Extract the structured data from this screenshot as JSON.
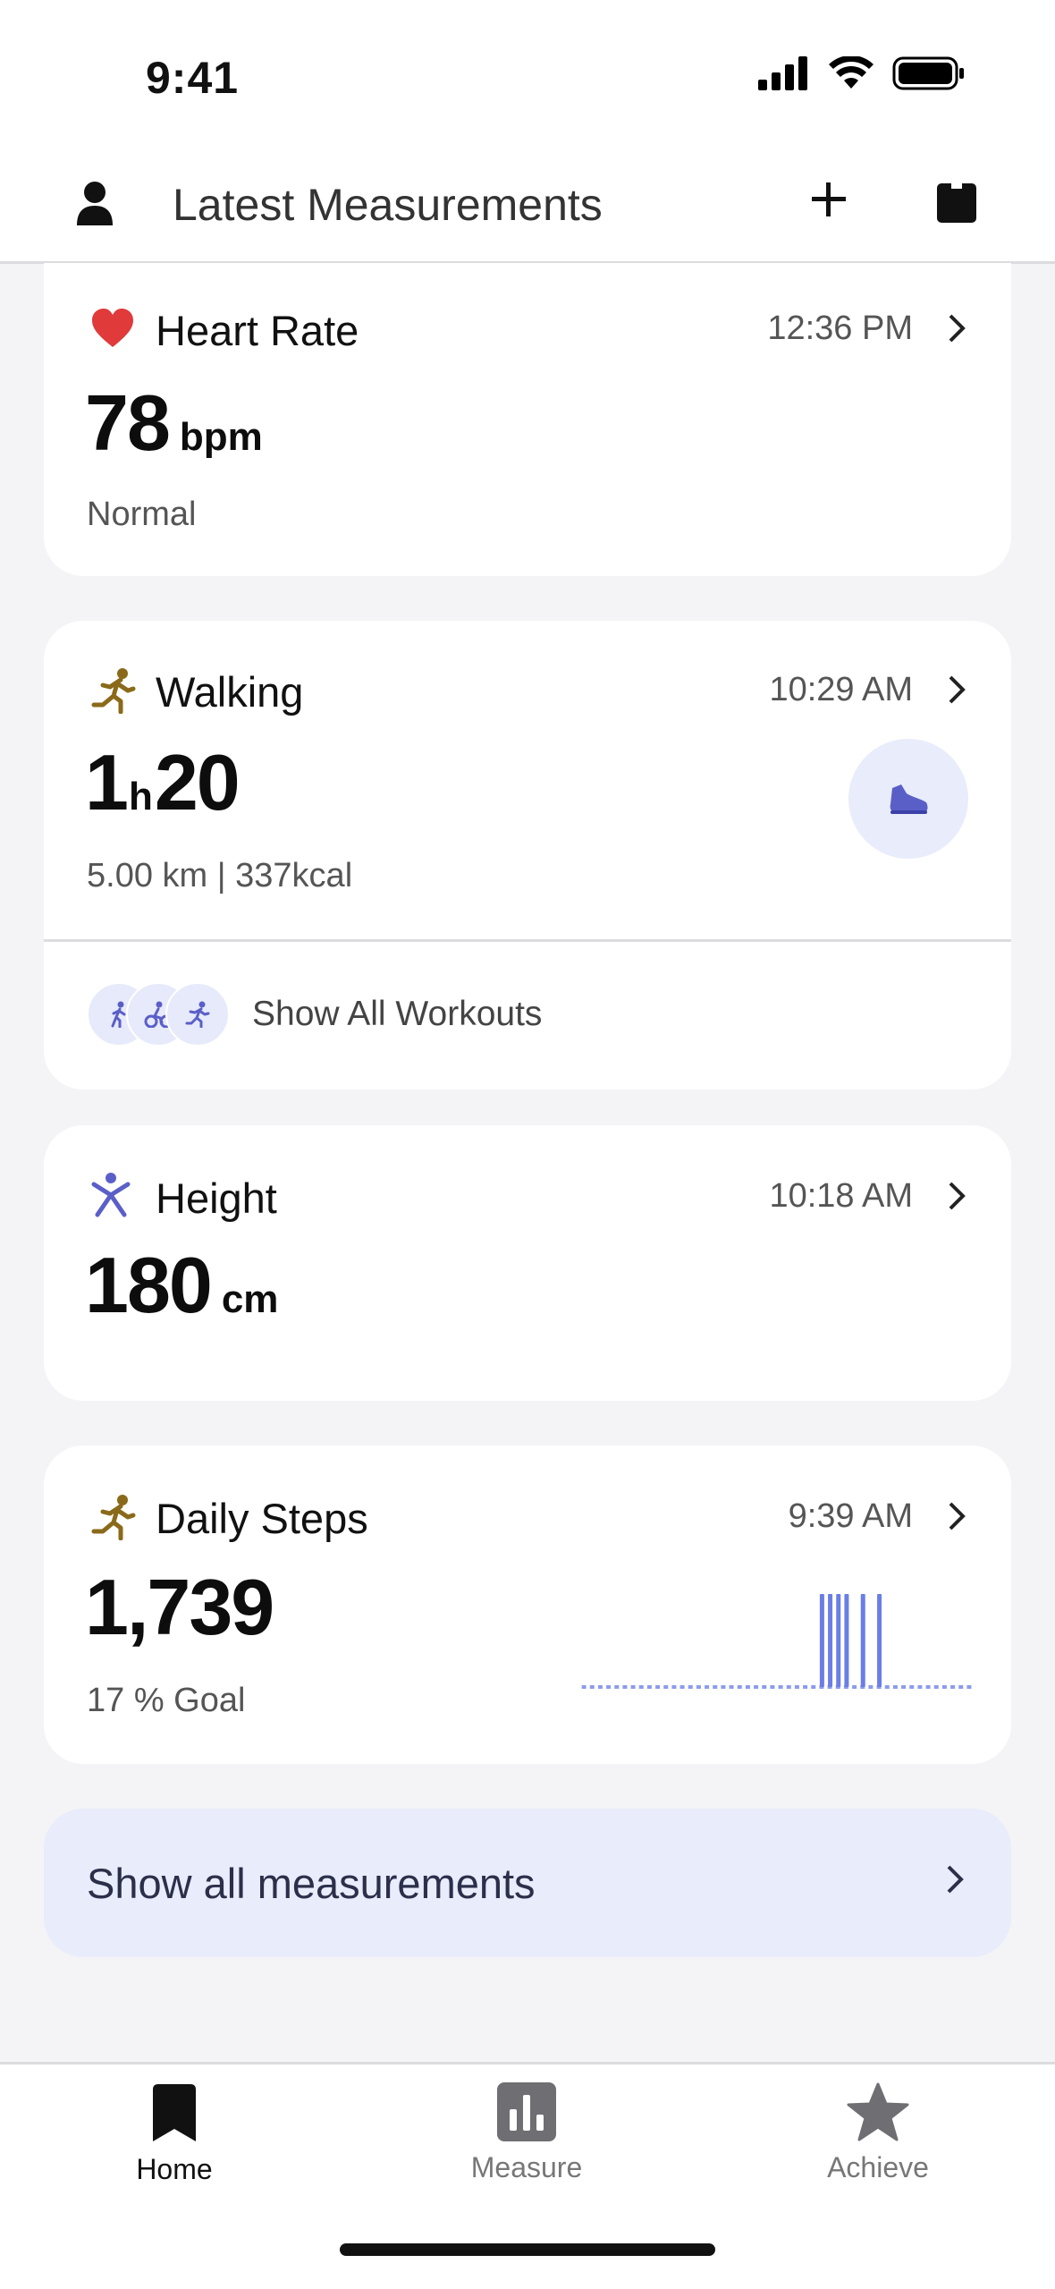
{
  "status": {
    "time": "9:41"
  },
  "header": {
    "title": "Latest Measurements"
  },
  "cards": {
    "heart": {
      "title": "Heart Rate",
      "time": "12:36 PM",
      "value": "78",
      "unit": "bpm",
      "status": "Normal"
    },
    "walking": {
      "title": "Walking",
      "time": "10:29 AM",
      "hours": "1",
      "hours_unit": "h",
      "minutes": "20",
      "detail": "5.00 km | 337kcal",
      "show_workouts": "Show All Workouts"
    },
    "height": {
      "title": "Height",
      "time": "10:18 AM",
      "value": "180",
      "unit": "cm"
    },
    "steps": {
      "title": "Daily Steps",
      "time": "9:39 AM",
      "value": "1,739",
      "goal": "17 % Goal"
    }
  },
  "chart_data": {
    "type": "bar",
    "bins": 48,
    "values": [
      0,
      0,
      0,
      0,
      0,
      0,
      0,
      0,
      0,
      0,
      0,
      0,
      0,
      0,
      0,
      0,
      0,
      0,
      0,
      0,
      0,
      0,
      0,
      0,
      0,
      0,
      0,
      0,
      0,
      1,
      1,
      1,
      1,
      0,
      1,
      0,
      1,
      0,
      0,
      0,
      0,
      0,
      0,
      0,
      0,
      0,
      0,
      0
    ],
    "color": "#6b7ee6",
    "baseline_color": "#8c9cec"
  },
  "show_all": {
    "label": "Show all measurements"
  },
  "tabs": [
    {
      "label": "Home",
      "active": true
    },
    {
      "label": "Measure",
      "active": false
    },
    {
      "label": "Achieve",
      "active": false
    }
  ],
  "colors": {
    "accent": "#6b7ee6",
    "heart": "#e03a3a",
    "walker": "#8a6a1a",
    "height": "#5a5fc8"
  }
}
